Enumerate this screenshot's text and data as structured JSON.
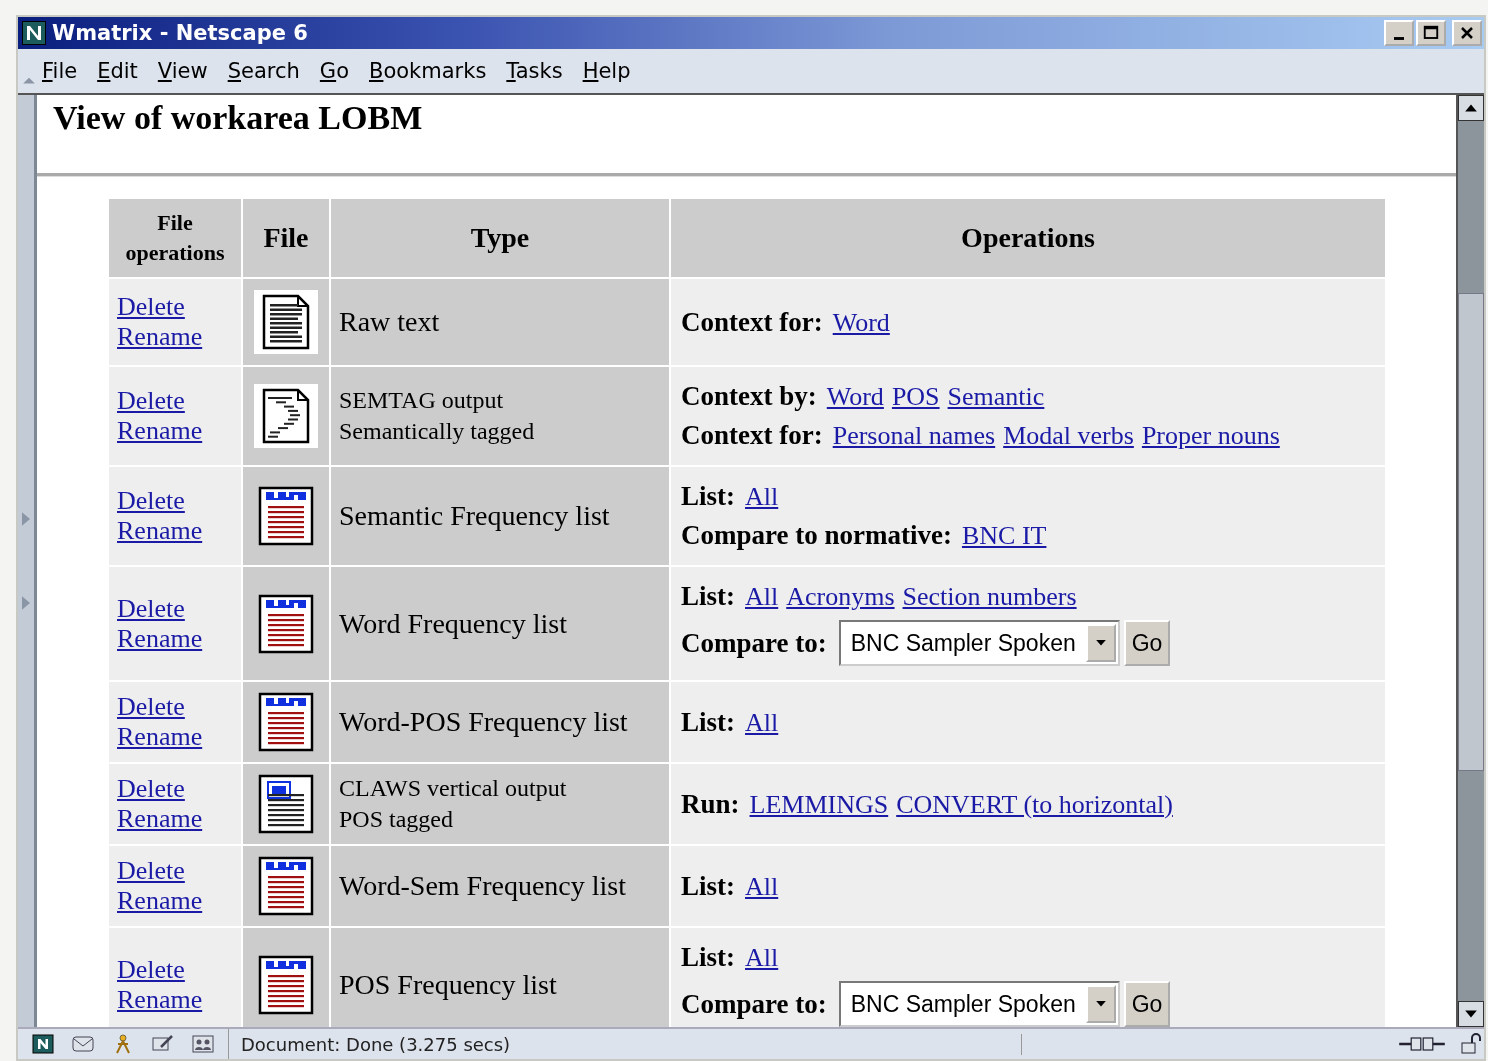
{
  "window": {
    "title": "Wmatrix - Netscape 6"
  },
  "menu": [
    "File",
    "Edit",
    "View",
    "Search",
    "Go",
    "Bookmarks",
    "Tasks",
    "Help"
  ],
  "heading": "View of workarea LOBM",
  "table": {
    "columns": [
      "File operations",
      "File",
      "Type",
      "Operations"
    ],
    "rows": [
      {
        "file_operations": [
          "Delete",
          "Rename"
        ],
        "file_icon": {
          "kind": "text"
        },
        "type": [
          "Raw text"
        ],
        "operations": [
          {
            "kind": "links",
            "label": "Context for:",
            "links": [
              "Word"
            ]
          }
        ]
      },
      {
        "file_operations": [
          "Delete",
          "Rename"
        ],
        "file_icon": {
          "kind": "semtag"
        },
        "type": [
          "SEMTAG output",
          "Semantically tagged"
        ],
        "operations": [
          {
            "kind": "links",
            "label": "Context by:",
            "links": [
              "Word",
              "POS",
              "Semantic"
            ]
          },
          {
            "kind": "links",
            "label": "Context for:",
            "links": [
              "Personal names",
              "Modal verbs",
              "Proper nouns"
            ]
          }
        ]
      },
      {
        "file_operations": [
          "Delete",
          "Rename"
        ],
        "file_icon": {
          "kind": "list"
        },
        "type": [
          "Semantic Frequency list"
        ],
        "operations": [
          {
            "kind": "links",
            "label": "List:",
            "links": [
              "All"
            ]
          },
          {
            "kind": "links",
            "label": "Compare to normative:",
            "links": [
              "BNC IT"
            ]
          }
        ]
      },
      {
        "file_operations": [
          "Delete",
          "Rename"
        ],
        "file_icon": {
          "kind": "list"
        },
        "type": [
          "Word Frequency list"
        ],
        "operations": [
          {
            "kind": "links",
            "label": "List:",
            "links": [
              "All",
              "Acronyms",
              "Section numbers"
            ]
          },
          {
            "kind": "select",
            "label": "Compare to:",
            "value": "BNC Sampler Spoken",
            "button": "Go"
          }
        ]
      },
      {
        "file_operations": [
          "Delete",
          "Rename"
        ],
        "file_icon": {
          "kind": "list"
        },
        "type": [
          "Word-POS Frequency list"
        ],
        "operations": [
          {
            "kind": "links",
            "label": "List:",
            "links": [
              "All"
            ]
          }
        ]
      },
      {
        "file_operations": [
          "Delete",
          "Rename"
        ],
        "file_icon": {
          "kind": "pos"
        },
        "type": [
          "CLAWS vertical output",
          "POS tagged"
        ],
        "operations": [
          {
            "kind": "links",
            "label": "Run:",
            "links": [
              "LEMMINGS",
              "CONVERT (to horizontal)"
            ]
          }
        ]
      },
      {
        "file_operations": [
          "Delete",
          "Rename"
        ],
        "file_icon": {
          "kind": "list"
        },
        "type": [
          "Word-Sem Frequency list"
        ],
        "operations": [
          {
            "kind": "links",
            "label": "List:",
            "links": [
              "All"
            ]
          }
        ]
      },
      {
        "file_operations": [
          "Delete",
          "Rename"
        ],
        "file_icon": {
          "kind": "list"
        },
        "type": [
          "POS Frequency list"
        ],
        "operations": [
          {
            "kind": "links",
            "label": "List:",
            "links": [
              "All"
            ]
          },
          {
            "kind": "select",
            "label": "Compare to:",
            "value": "BNC Sampler Spoken",
            "button": "Go"
          }
        ]
      }
    ]
  },
  "status_bar": {
    "text": "Document: Done (3.275 secs)"
  }
}
